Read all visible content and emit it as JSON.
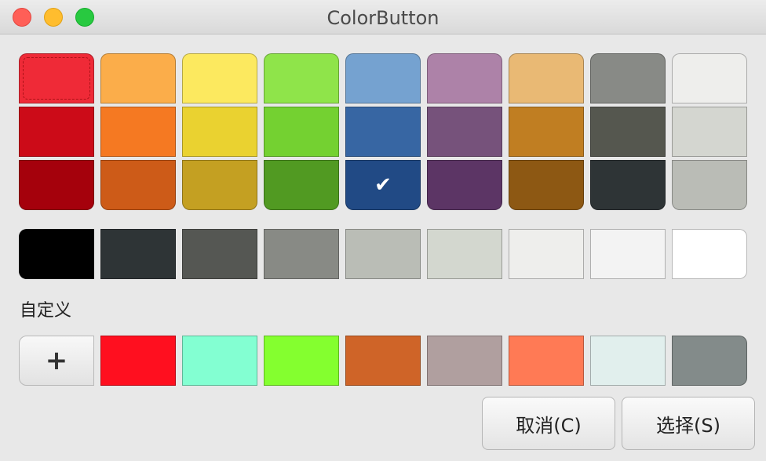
{
  "window": {
    "title": "ColorButton"
  },
  "palette": {
    "rows": [
      [
        "#ef2a37",
        "#fbad4a",
        "#fce95f",
        "#8fe44a",
        "#75a2d0",
        "#ad82a8",
        "#e9b974",
        "#888a86",
        "#eeeeec"
      ],
      [
        "#cc0b18",
        "#f57922",
        "#ead230",
        "#74d131",
        "#3766a3",
        "#76527b",
        "#c07e22",
        "#55574f",
        "#d4d6d0"
      ],
      [
        "#a5010c",
        "#cd5b18",
        "#c4a022",
        "#519a22",
        "#214a85",
        "#5c3565",
        "#8d5813",
        "#2e3436",
        "#babcb6"
      ]
    ],
    "selected_row": 2,
    "selected_col": 4,
    "focused_row": 0,
    "focused_col": 0,
    "check_glyph": "✔"
  },
  "grays": [
    "#000000",
    "#2e3436",
    "#555753",
    "#888a85",
    "#babdb6",
    "#d3d7cf",
    "#eeeeec",
    "#f3f3f3",
    "#ffffff"
  ],
  "custom": {
    "label": "自定义",
    "add_label": "+",
    "colors": [
      "#ff0f1f",
      "#83ffd2",
      "#84ff2f",
      "#cf6428",
      "#b09f9f",
      "#ff7a55",
      "#e1efed",
      "#838b8a"
    ]
  },
  "buttons": {
    "cancel": "取消(C)",
    "select": "选择(S)"
  }
}
